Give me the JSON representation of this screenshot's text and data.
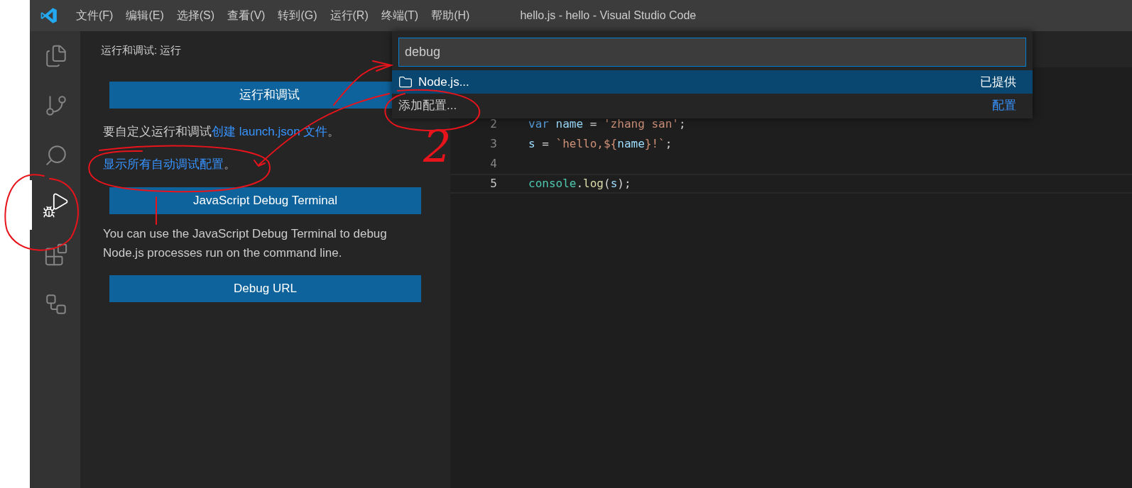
{
  "title_bar": {
    "menu": [
      "文件(F)",
      "编辑(E)",
      "选择(S)",
      "查看(V)",
      "转到(G)",
      "运行(R)",
      "终端(T)",
      "帮助(H)"
    ],
    "title": "hello.js - hello - Visual Studio Code"
  },
  "activity_bar": {
    "items": [
      {
        "kind": "explorer",
        "selected": false
      },
      {
        "kind": "source-control",
        "selected": false
      },
      {
        "kind": "search",
        "selected": false
      },
      {
        "kind": "run-debug",
        "selected": true
      },
      {
        "kind": "extensions",
        "selected": false
      },
      {
        "kind": "remote",
        "selected": false
      }
    ]
  },
  "sidebar": {
    "title": "运行和调试: 运行",
    "run_button": "运行和调试",
    "customize_text": "要自定义运行和调试",
    "create_link": "创建 launch.json 文件",
    "customize_end": "。",
    "show_all_link": "显示所有自动调试配置",
    "show_all_end": "。",
    "terminal_button": "JavaScript Debug Terminal",
    "terminal_description": "You can use the JavaScript Debug Terminal to debug Node.js processes run on the command line.",
    "url_button": "Debug URL"
  },
  "quick_pick": {
    "query": "debug",
    "items": [
      {
        "kind": "provider",
        "label": "Node.js...",
        "detail": "已提供",
        "selected": true
      },
      {
        "kind": "action",
        "label": "添加配置...",
        "detail": "配置",
        "selected": false
      }
    ]
  },
  "editor": {
    "lines": [
      {
        "number": "2",
        "current": false,
        "tokens": [
          {
            "kind": "keyword",
            "text": "var"
          },
          {
            "kind": "variable",
            "text": " name"
          },
          {
            "kind": "plain",
            "text": " = "
          },
          {
            "kind": "string",
            "text": "'zhang san'"
          },
          {
            "kind": "plain",
            "text": ";"
          }
        ]
      },
      {
        "number": "3",
        "current": false,
        "tokens": [
          {
            "kind": "variable",
            "text": "s"
          },
          {
            "kind": "plain",
            "text": " = "
          },
          {
            "kind": "string",
            "text": "`hello,${"
          },
          {
            "kind": "variable",
            "text": "name"
          },
          {
            "kind": "string",
            "text": "}!`"
          },
          {
            "kind": "plain",
            "text": ";"
          }
        ]
      },
      {
        "number": "4",
        "current": false
      },
      {
        "number": "5",
        "current": true,
        "tokens": [
          {
            "kind": "class",
            "text": "console"
          },
          {
            "kind": "plain",
            "text": "."
          },
          {
            "kind": "function",
            "text": "log"
          },
          {
            "kind": "plain",
            "text": "("
          },
          {
            "kind": "variable",
            "text": "s"
          },
          {
            "kind": "plain",
            "text": ");"
          }
        ]
      }
    ]
  },
  "annotations": {
    "number": "2"
  }
}
